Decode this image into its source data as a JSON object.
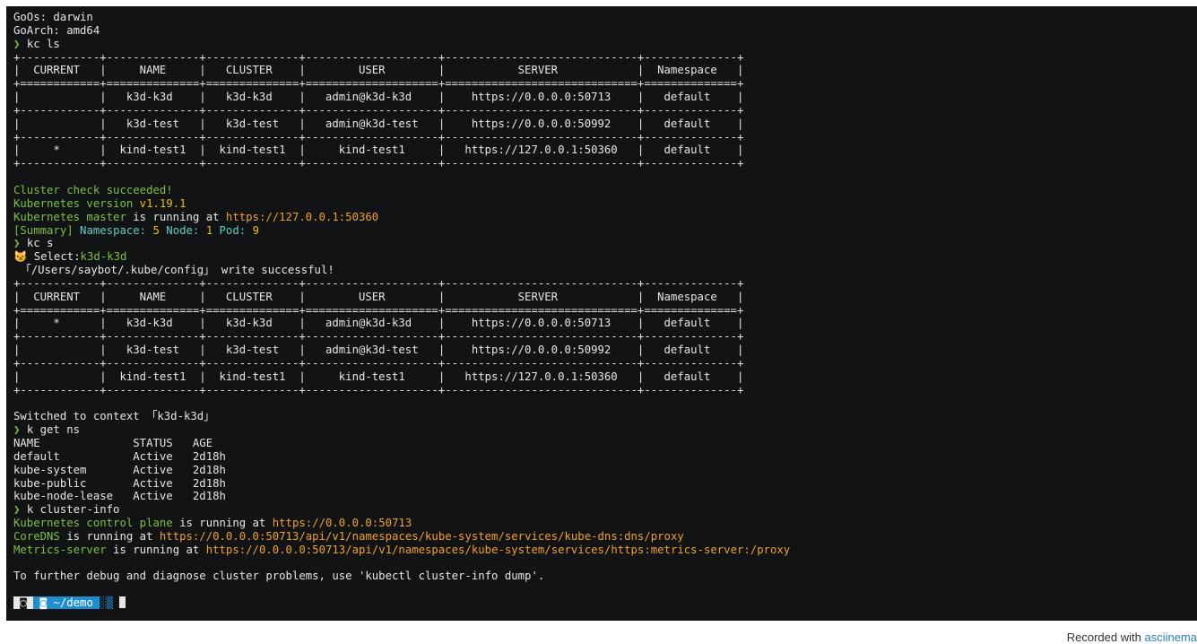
{
  "colors": {
    "background": "#121314",
    "default": "#e6e6e6",
    "green": "#7ac143",
    "yellow": "#e6c200",
    "orange": "#f0a030",
    "teal": "#5fcfc0",
    "blue": "#1f8ecc",
    "link": "#2d7fbf"
  },
  "terminal": {
    "lines": [
      [
        {
          "t": "GoOs: darwin"
        }
      ],
      [
        {
          "t": "GoArch: amd64"
        }
      ],
      [
        {
          "t": "❯ ",
          "c": "green"
        },
        {
          "t": "kc ls"
        }
      ],
      [
        {
          "t": "+------------+--------------+--------------+--------------------+-----------------------------+--------------+"
        }
      ],
      [
        {
          "t": "|  CURRENT   |     NAME     |   CLUSTER    |        USER        |           SERVER            |  Namespace   |"
        }
      ],
      [
        {
          "t": "+============+==============+==============+====================+=============================+==============+"
        }
      ],
      [
        {
          "t": "|            |   k3d-k3d    |   k3d-k3d    |   admin@k3d-k3d    |    https://0.0.0.0:50713    |   default    |"
        }
      ],
      [
        {
          "t": "+------------+--------------+--------------+--------------------+-----------------------------+--------------+"
        }
      ],
      [
        {
          "t": "|            |   k3d-test   |   k3d-test   |   admin@k3d-test   |    https://0.0.0.0:50992    |   default    |"
        }
      ],
      [
        {
          "t": "+------------+--------------+--------------+--------------------+-----------------------------+--------------+"
        }
      ],
      [
        {
          "t": "|     *      |  kind-test1  |  kind-test1  |     kind-test1     |   https://127.0.0.1:50360   |   default    |"
        }
      ],
      [
        {
          "t": "+------------+--------------+--------------+--------------------+-----------------------------+--------------+"
        }
      ],
      [
        {
          "t": ""
        }
      ],
      [
        {
          "t": "Cluster check succeeded!",
          "c": "green"
        }
      ],
      [
        {
          "t": "Kubernetes version ",
          "c": "green"
        },
        {
          "t": "v1.19.1",
          "c": "yellow"
        }
      ],
      [
        {
          "t": "Kubernetes master",
          "c": "green"
        },
        {
          "t": " is running at "
        },
        {
          "t": "https://127.0.0.1:50360",
          "c": "orange"
        }
      ],
      [
        {
          "t": "[Summary] ",
          "c": "green"
        },
        {
          "t": "Namespace: ",
          "c": "teal"
        },
        {
          "t": "5 ",
          "c": "yellow"
        },
        {
          "t": "Node: ",
          "c": "teal"
        },
        {
          "t": "1 ",
          "c": "yellow"
        },
        {
          "t": "Pod: ",
          "c": "teal"
        },
        {
          "t": "9",
          "c": "yellow"
        }
      ],
      [
        {
          "t": "❯ ",
          "c": "green"
        },
        {
          "t": "kc s"
        }
      ],
      [
        {
          "t": "😼 ",
          "c": "orange"
        },
        {
          "t": "Select:"
        },
        {
          "t": "k3d-k3d",
          "c": "green"
        }
      ],
      [
        {
          "t": " 「/Users/saybot/.kube/config」 write successful!"
        }
      ],
      [
        {
          "t": "+------------+--------------+--------------+--------------------+-----------------------------+--------------+"
        }
      ],
      [
        {
          "t": "|  CURRENT   |     NAME     |   CLUSTER    |        USER        |           SERVER            |  Namespace   |"
        }
      ],
      [
        {
          "t": "+============+==============+==============+====================+=============================+==============+"
        }
      ],
      [
        {
          "t": "|     *      |   k3d-k3d    |   k3d-k3d    |   admin@k3d-k3d    |    https://0.0.0.0:50713    |   default    |"
        }
      ],
      [
        {
          "t": "+------------+--------------+--------------+--------------------+-----------------------------+--------------+"
        }
      ],
      [
        {
          "t": "|            |   k3d-test   |   k3d-test   |   admin@k3d-test   |    https://0.0.0.0:50992    |   default    |"
        }
      ],
      [
        {
          "t": "+------------+--------------+--------------+--------------------+-----------------------------+--------------+"
        }
      ],
      [
        {
          "t": "|            |  kind-test1  |  kind-test1  |     kind-test1     |   https://127.0.0.1:50360   |   default    |"
        }
      ],
      [
        {
          "t": "+------------+--------------+--------------+--------------------+-----------------------------+--------------+"
        }
      ],
      [
        {
          "t": ""
        }
      ],
      [
        {
          "t": "Switched to context 「k3d-k3d」"
        }
      ],
      [
        {
          "t": "❯ ",
          "c": "green"
        },
        {
          "t": "k get ns"
        }
      ],
      [
        {
          "t": "NAME              STATUS   AGE"
        }
      ],
      [
        {
          "t": "default           Active   2d18h"
        }
      ],
      [
        {
          "t": "kube-system       Active   2d18h"
        }
      ],
      [
        {
          "t": "kube-public       Active   2d18h"
        }
      ],
      [
        {
          "t": "kube-node-lease   Active   2d18h"
        }
      ],
      [
        {
          "t": "❯ ",
          "c": "green"
        },
        {
          "t": "k cluster-info"
        }
      ],
      [
        {
          "t": "Kubernetes control plane",
          "c": "green"
        },
        {
          "t": " is running at "
        },
        {
          "t": "https://0.0.0.0:50713",
          "c": "orange"
        }
      ],
      [
        {
          "t": "CoreDNS",
          "c": "green"
        },
        {
          "t": " is running at "
        },
        {
          "t": "https://0.0.0.0:50713/api/v1/namespaces/kube-system/services/kube-dns:dns/proxy",
          "c": "orange"
        }
      ],
      [
        {
          "t": "Metrics-server",
          "c": "green"
        },
        {
          "t": " is running at "
        },
        {
          "t": "https://0.0.0.0:50713/api/v1/namespaces/kube-system/services/https:metrics-server:/proxy",
          "c": "orange"
        }
      ],
      [
        {
          "t": ""
        }
      ],
      [
        {
          "t": "To further debug and diagnose cluster problems, use 'kubectl cluster-info dump'."
        }
      ],
      [
        {
          "t": ""
        }
      ]
    ],
    "prompt": {
      "status_glyph": " ◙ ",
      "path": " ◙ ~/demo ",
      "tail": "░▒"
    }
  },
  "footer": {
    "prefix": "Recorded with ",
    "link_text": "asciinema"
  }
}
